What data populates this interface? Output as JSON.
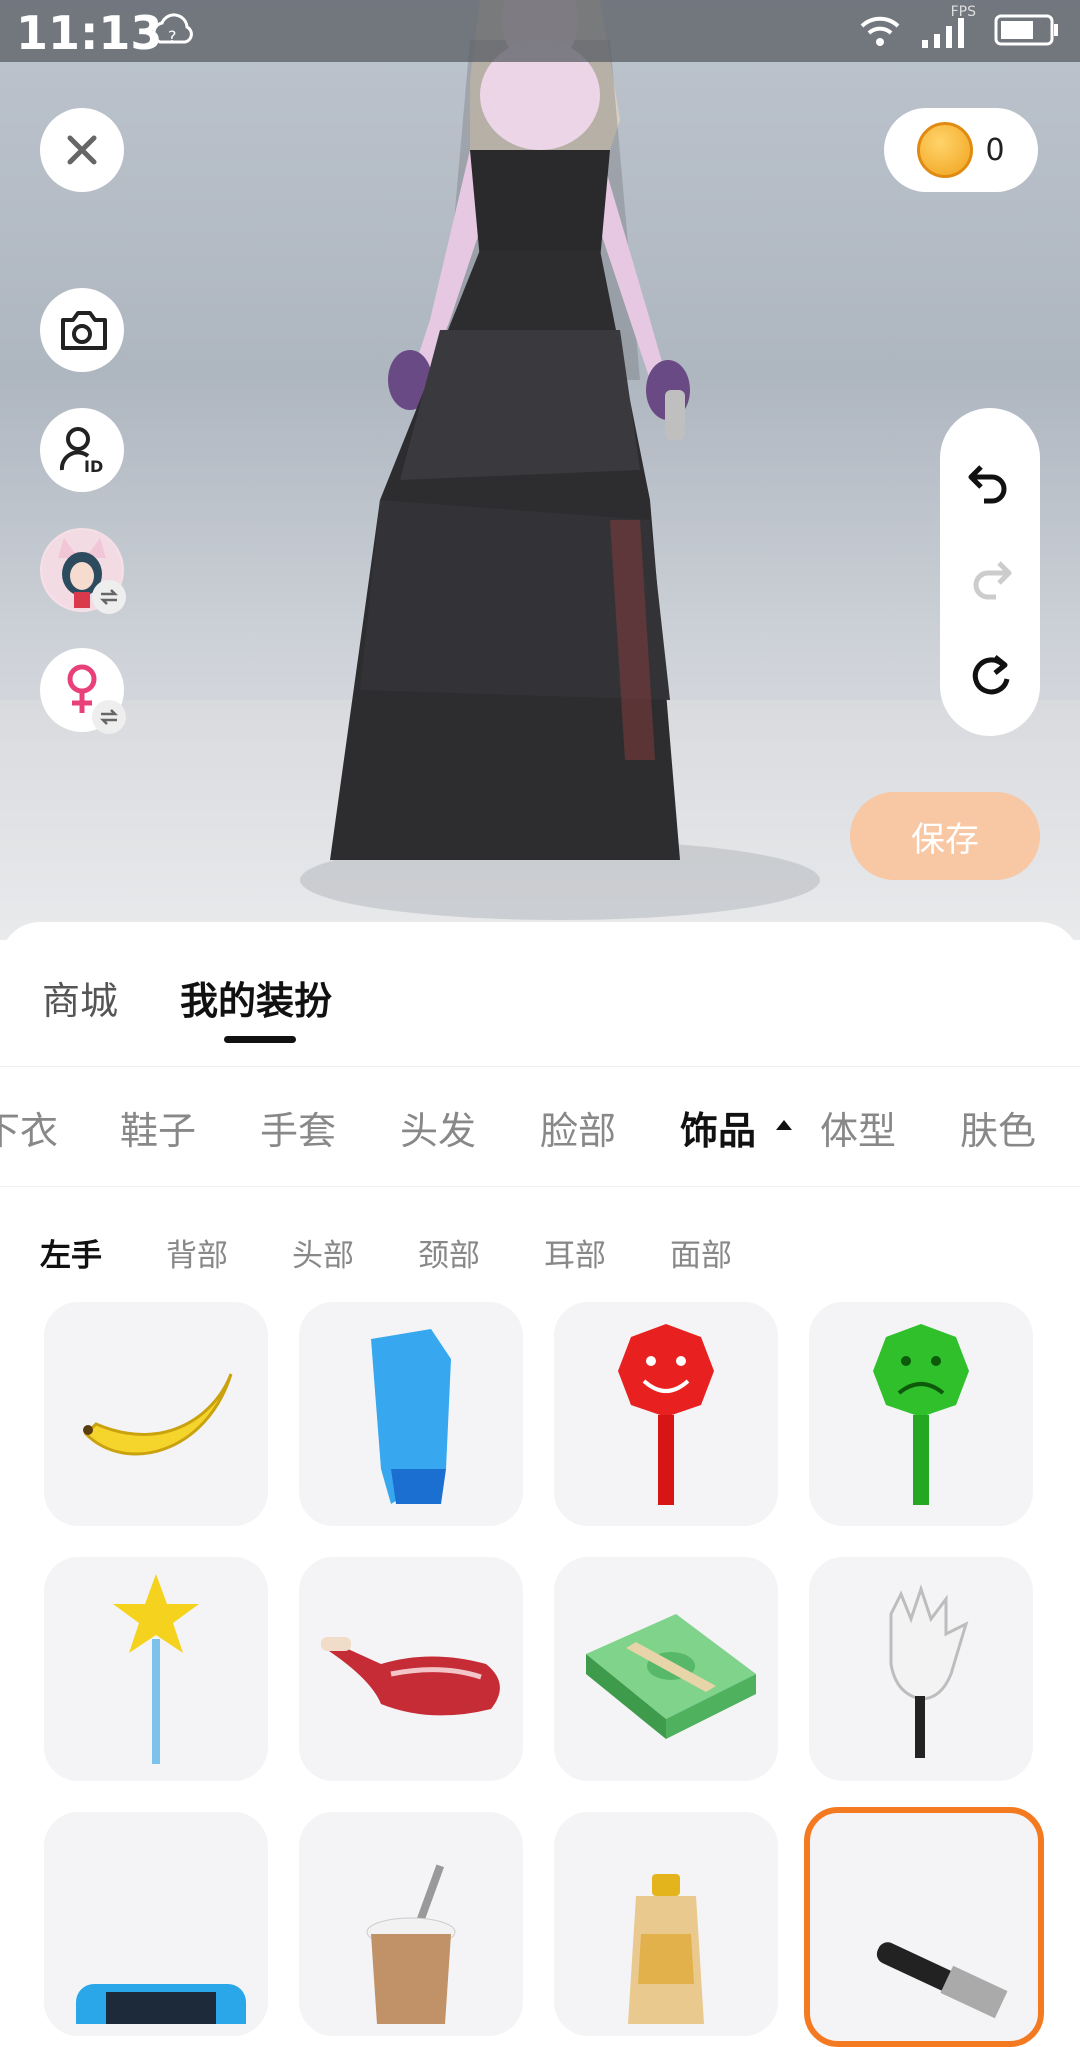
{
  "status_bar": {
    "time": "11:13",
    "fps_label": "FPS"
  },
  "top": {
    "coin_count": "0"
  },
  "actions": {
    "save_label": "保存"
  },
  "tabs": [
    {
      "label": "商城",
      "active": false
    },
    {
      "label": "我的装扮",
      "active": true
    }
  ],
  "categories": [
    {
      "label": "下衣",
      "active": false
    },
    {
      "label": "鞋子",
      "active": false
    },
    {
      "label": "手套",
      "active": false
    },
    {
      "label": "头发",
      "active": false
    },
    {
      "label": "脸部",
      "active": false
    },
    {
      "label": "饰品",
      "active": true
    },
    {
      "label": "体型",
      "active": false
    },
    {
      "label": "肤色",
      "active": false
    }
  ],
  "subcategories": [
    {
      "label": "左手",
      "active": true
    },
    {
      "label": "背部",
      "active": false
    },
    {
      "label": "头部",
      "active": false
    },
    {
      "label": "颈部",
      "active": false
    },
    {
      "label": "耳部",
      "active": false
    },
    {
      "label": "面部",
      "active": false
    }
  ],
  "items": [
    {
      "icon": "banana-icon"
    },
    {
      "icon": "boxing-glove-icon"
    },
    {
      "icon": "smiley-sign-icon"
    },
    {
      "icon": "sad-sign-icon"
    },
    {
      "icon": "star-wand-icon"
    },
    {
      "icon": "meat-icon"
    },
    {
      "icon": "money-stack-icon"
    },
    {
      "icon": "glove-hand-icon"
    },
    {
      "icon": "game-console-icon"
    },
    {
      "icon": "drink-cup-icon"
    },
    {
      "icon": "bottle-icon"
    },
    {
      "icon": "tool-icon"
    }
  ],
  "colors": {
    "accent": "#f47a22",
    "save_bg": "#f8c7a4",
    "gender_icon": "#e8417a"
  }
}
